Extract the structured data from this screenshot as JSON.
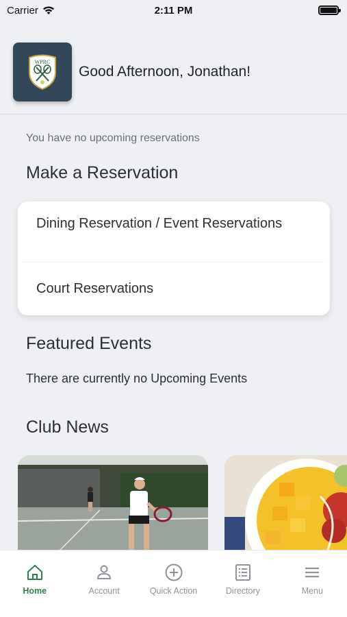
{
  "status_bar": {
    "carrier": "Carrier",
    "time": "2:11 PM"
  },
  "header": {
    "logo_text": "WPRC",
    "greeting": "Good Afternoon, Jonathan!"
  },
  "reservations": {
    "empty_text": "You have no upcoming reservations"
  },
  "make_reservation": {
    "title": "Make a Reservation",
    "items": [
      {
        "label": "Dining Reservation / Event Reservations"
      },
      {
        "label": "Court Reservations"
      }
    ]
  },
  "featured_events": {
    "title": "Featured Events",
    "empty_text": "There are currently no Upcoming Events"
  },
  "club_news": {
    "title": "Club News"
  },
  "tabs": [
    {
      "label": "Home",
      "icon": "home-icon",
      "active": true
    },
    {
      "label": "Account",
      "icon": "account-icon",
      "active": false
    },
    {
      "label": "Quick Action",
      "icon": "plus-circle-icon",
      "active": false
    },
    {
      "label": "Directory",
      "icon": "directory-icon",
      "active": false
    },
    {
      "label": "Menu",
      "icon": "menu-icon",
      "active": false
    }
  ],
  "colors": {
    "accent": "#2e7d4f",
    "logo_bg": "#33475b",
    "background": "#eef0f4"
  }
}
